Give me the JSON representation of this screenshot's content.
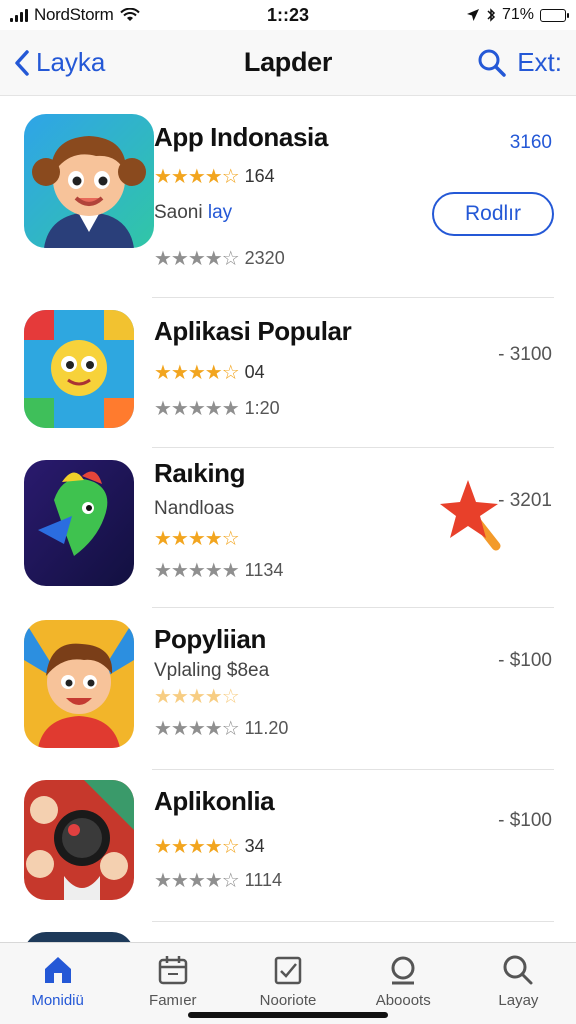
{
  "status_bar": {
    "carrier": "NordStorm",
    "time": "1::23",
    "battery": "71%",
    "battery_level": 0.71
  },
  "nav": {
    "back_label": "Layka",
    "title": "Lapder",
    "right_label": "Ext:"
  },
  "apps": [
    {
      "title": "App Indonasia",
      "rating_count": "164",
      "subtitle_main": "Saoni",
      "subtitle_accent": "lay",
      "secondary_count": "2320",
      "price": "3160",
      "get_label": "Rodlır"
    },
    {
      "title": "Aplikasi Popular",
      "rating_count": "04",
      "secondary_count": "1:20",
      "price": "- 3100"
    },
    {
      "title": "Raıking",
      "subtitle_main": "Nandloas",
      "secondary_count": "1134",
      "price": "- 3201"
    },
    {
      "title": "Popyliian",
      "subtitle_main": "Vplaling $8ea",
      "secondary_count": "11.20",
      "price": "- $100"
    },
    {
      "title": "Aplikonlia",
      "rating_count": "34",
      "secondary_count": "1114",
      "price": "- $100"
    }
  ],
  "tabs": [
    {
      "label": "Monidiü",
      "icon": "home-icon",
      "active": true
    },
    {
      "label": "Famıer",
      "icon": "calendar-icon",
      "active": false
    },
    {
      "label": "Nooriote",
      "icon": "checklist-icon",
      "active": false
    },
    {
      "label": "Abooots",
      "icon": "search-icon",
      "active": false
    },
    {
      "label": "Layay",
      "icon": "search-icon",
      "active": false
    }
  ],
  "colors": {
    "accent": "#2458d6",
    "star_gold": "#f2a51f",
    "star_gray": "#8f8f8f",
    "badge_red": "#e8402a"
  }
}
